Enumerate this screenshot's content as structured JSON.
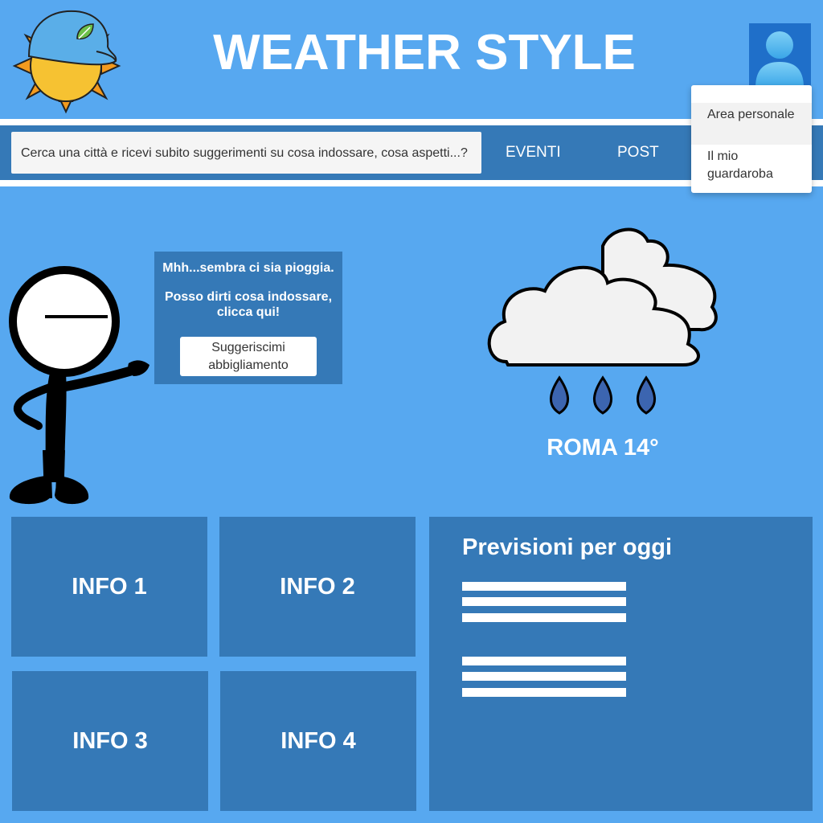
{
  "header": {
    "title": "WEATHER STYLE",
    "logo_icon": "sun-with-cap-icon",
    "user_icon": "user-avatar-icon"
  },
  "search": {
    "placeholder": "Cerca una città e ricevi subito suggerimenti su cosa indossare, cosa aspetti...?"
  },
  "nav": {
    "items": [
      "EVENTI",
      "POST"
    ]
  },
  "user_menu": {
    "items": [
      "Area personale",
      "Il mio guardaroba"
    ]
  },
  "suggestion": {
    "line1": "Mhh...sembra ci sia pioggia.",
    "line2": "Posso dirti cosa indossare, clicca qui!",
    "button_label": "Suggeriscimi abbigliamento"
  },
  "weather": {
    "icon": "rain-cloud-icon",
    "city_temp": "ROMA 14°"
  },
  "info_tiles": [
    "INFO 1",
    "INFO 2",
    "INFO 3",
    "INFO 4"
  ],
  "forecast": {
    "title": "Previsioni per oggi"
  },
  "colors": {
    "background": "#57a8f0",
    "panel": "#3579b7",
    "white": "#ffffff"
  }
}
